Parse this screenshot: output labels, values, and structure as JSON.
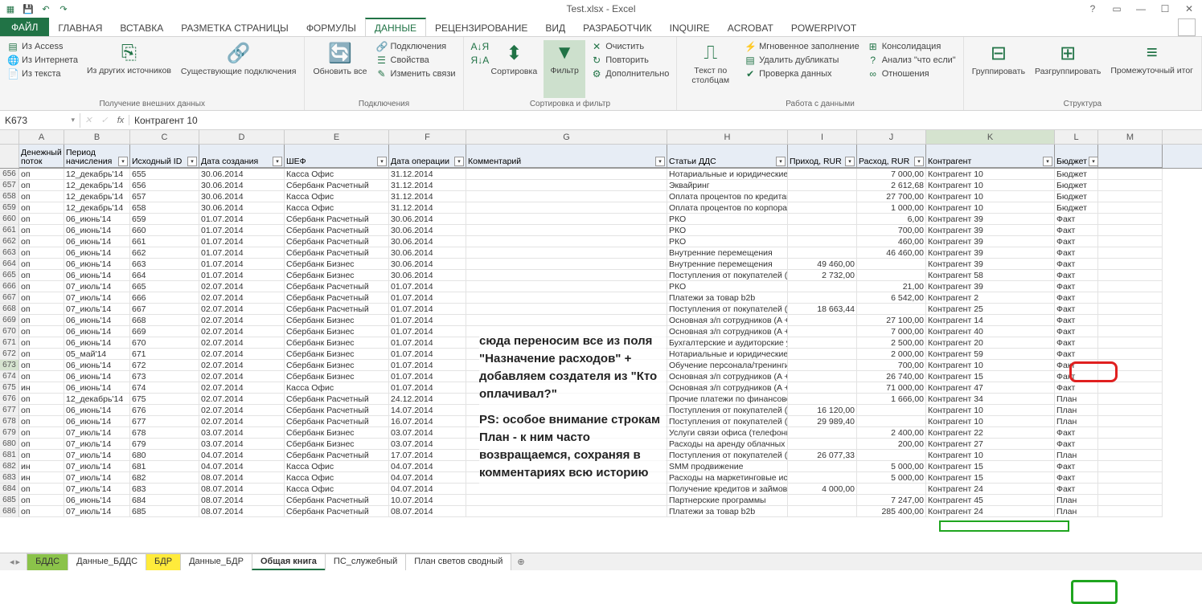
{
  "title": "Test.xlsx - Excel",
  "qat": {
    "save": "💾",
    "undo": "↶",
    "redo": "↷"
  },
  "tabs": {
    "file": "ФАЙЛ",
    "items": [
      "ГЛАВНАЯ",
      "ВСТАВКА",
      "РАЗМЕТКА СТРАНИЦЫ",
      "ФОРМУЛЫ",
      "ДАННЫЕ",
      "РЕЦЕНЗИРОВАНИЕ",
      "ВИД",
      "РАЗРАБОТЧИК",
      "INQUIRE",
      "ACROBAT",
      "POWERPIVOT"
    ],
    "active": "ДАННЫЕ"
  },
  "ribbon": {
    "ext": {
      "access": "Из Access",
      "web": "Из Интернета",
      "text": "Из текста",
      "other": "Из других источников",
      "existing": "Существующие подключения",
      "label": "Получение внешних данных"
    },
    "conn": {
      "refresh": "Обновить все",
      "connections": "Подключения",
      "properties": "Свойства",
      "editlinks": "Изменить связи",
      "label": "Подключения"
    },
    "sort": {
      "az": "А↓Я",
      "za": "Я↓А",
      "sort": "Сортировка",
      "filter": "Фильтр",
      "clear": "Очистить",
      "reapply": "Повторить",
      "advanced": "Дополнительно",
      "label": "Сортировка и фильтр"
    },
    "dtools": {
      "ttc": "Текст по столбцам",
      "flash": "Мгновенное заполнение",
      "dup": "Удалить дубликаты",
      "valid": "Проверка данных",
      "consol": "Консолидация",
      "whatif": "Анализ \"что если\"",
      "rel": "Отношения",
      "label": "Работа с данными"
    },
    "outline": {
      "group": "Группировать",
      "ungroup": "Разгруппировать",
      "subtotal": "Промежуточный итог",
      "label": "Структура"
    }
  },
  "namebox": "K673",
  "formula": "Контрагент 10",
  "columns": [
    "A",
    "B",
    "C",
    "D",
    "E",
    "F",
    "G",
    "H",
    "I",
    "J",
    "K",
    "L",
    "M"
  ],
  "headers": {
    "A": "Денежный поток",
    "B": "Период начисления",
    "C": "Исходный ID",
    "D": "Дата создания",
    "E": "ШЕФ",
    "F": "Дата операции",
    "G": "Комментарий",
    "H": "Статьи ДДС",
    "I": "Приход, RUR",
    "J": "Расход, RUR",
    "K": "Контрагент",
    "L": "Бюджет"
  },
  "comment_overlay": [
    "сюда переносим все из поля \"Назначение расходов\" + добавляем создателя из \"Кто оплачивал?\"",
    "PS: особое внимание строкам План - к ним часто возвращаемся, сохраняя в комментариях всю историю"
  ],
  "rows": [
    {
      "n": 656,
      "A": "оп",
      "B": "12_декабрь'14",
      "C": "655",
      "D": "30.06.2014",
      "E": "Касса Офис",
      "F": "31.12.2014",
      "H": "Нотариальные и юридические услуги",
      "I": "",
      "J": "7 000,00",
      "K": "Контрагент 10",
      "L": "Бюджет"
    },
    {
      "n": 657,
      "A": "оп",
      "B": "12_декабрь'14",
      "C": "656",
      "D": "30.06.2014",
      "E": "Сбербанк Расчетный",
      "F": "31.12.2014",
      "H": "Эквайринг",
      "I": "",
      "J": "2 612,68",
      "K": "Контрагент 10",
      "L": "Бюджет"
    },
    {
      "n": 658,
      "A": "оп",
      "B": "12_декабрь'14",
      "C": "657",
      "D": "30.06.2014",
      "E": "Касса Офис",
      "F": "31.12.2014",
      "H": "Оплата процентов по кредитам и займам",
      "I": "",
      "J": "27 700,00",
      "K": "Контрагент 10",
      "L": "Бюджет"
    },
    {
      "n": 659,
      "A": "оп",
      "B": "12_декабрь'14",
      "C": "658",
      "D": "30.06.2014",
      "E": "Касса Офис",
      "F": "31.12.2014",
      "H": "Оплата процентов по корпоративной кредитной",
      "I": "",
      "J": "1 000,00",
      "K": "Контрагент 10",
      "L": "Бюджет"
    },
    {
      "n": 660,
      "A": "оп",
      "B": "06_июнь'14",
      "C": "659",
      "D": "01.07.2014",
      "E": "Сбербанк Расчетный",
      "F": "30.06.2014",
      "H": "РКО",
      "I": "",
      "J": "6,00",
      "K": "Контрагент 39",
      "L": "Факт"
    },
    {
      "n": 661,
      "A": "оп",
      "B": "06_июнь'14",
      "C": "660",
      "D": "01.07.2014",
      "E": "Сбербанк Расчетный",
      "F": "30.06.2014",
      "H": "РКО",
      "I": "",
      "J": "700,00",
      "K": "Контрагент 39",
      "L": "Факт"
    },
    {
      "n": 662,
      "A": "оп",
      "B": "06_июнь'14",
      "C": "661",
      "D": "01.07.2014",
      "E": "Сбербанк Расчетный",
      "F": "30.06.2014",
      "H": "РКО",
      "I": "",
      "J": "460,00",
      "K": "Контрагент 39",
      "L": "Факт"
    },
    {
      "n": 663,
      "A": "оп",
      "B": "06_июнь'14",
      "C": "662",
      "D": "01.07.2014",
      "E": "Сбербанк Расчетный",
      "F": "30.06.2014",
      "H": "Внутренние перемещения",
      "I": "",
      "J": "46 460,00",
      "K": "Контрагент 39",
      "L": "Факт"
    },
    {
      "n": 664,
      "A": "оп",
      "B": "06_июнь'14",
      "C": "663",
      "D": "01.07.2014",
      "E": "Сбербанк Бизнес",
      "F": "30.06.2014",
      "H": "Внутренние перемещения",
      "I": "49 460,00",
      "J": "",
      "K": "Контрагент 39",
      "L": "Факт"
    },
    {
      "n": 665,
      "A": "оп",
      "B": "06_июнь'14",
      "C": "664",
      "D": "01.07.2014",
      "E": "Сбербанк Бизнес",
      "F": "30.06.2014",
      "H": "Поступления от покупателей (",
      "I": "2 732,00",
      "J": "",
      "K": "Контрагент 58",
      "L": "Факт"
    },
    {
      "n": 666,
      "A": "оп",
      "B": "07_июль'14",
      "C": "665",
      "D": "02.07.2014",
      "E": "Сбербанк Расчетный",
      "F": "01.07.2014",
      "H": "РКО",
      "I": "",
      "J": "21,00",
      "K": "Контрагент 39",
      "L": "Факт"
    },
    {
      "n": 667,
      "A": "оп",
      "B": "07_июль'14",
      "C": "666",
      "D": "02.07.2014",
      "E": "Сбербанк Расчетный",
      "F": "01.07.2014",
      "H": "Платежи за товар b2b",
      "I": "",
      "J": "6 542,00",
      "K": "Контрагент 2",
      "L": "Факт"
    },
    {
      "n": 668,
      "A": "оп",
      "B": "07_июль'14",
      "C": "667",
      "D": "02.07.2014",
      "E": "Сбербанк Расчетный",
      "F": "01.07.2014",
      "H": "Поступления от покупателей (",
      "I": "18 663,44",
      "J": "",
      "K": "Контрагент 25",
      "L": "Факт"
    },
    {
      "n": 669,
      "A": "оп",
      "B": "06_июнь'14",
      "C": "668",
      "D": "02.07.2014",
      "E": "Сбербанк Бизнес",
      "F": "01.07.2014",
      "H": "Основная з/п сотрудников (A + Z)",
      "I": "",
      "J": "27 100,00",
      "K": "Контрагент 14",
      "L": "Факт"
    },
    {
      "n": 670,
      "A": "оп",
      "B": "06_июнь'14",
      "C": "669",
      "D": "02.07.2014",
      "E": "Сбербанк Бизнес",
      "F": "01.07.2014",
      "H": "Основная з/п сотрудников (A + Z)",
      "I": "",
      "J": "7 000,00",
      "K": "Контрагент 40",
      "L": "Факт"
    },
    {
      "n": 671,
      "A": "оп",
      "B": "06_июнь'14",
      "C": "670",
      "D": "02.07.2014",
      "E": "Сбербанк Бизнес",
      "F": "01.07.2014",
      "H": "Бухгалтерские и аудиторские услуги",
      "I": "",
      "J": "2 500,00",
      "K": "Контрагент 20",
      "L": "Факт"
    },
    {
      "n": 672,
      "A": "оп",
      "B": "05_май'14",
      "C": "671",
      "D": "02.07.2014",
      "E": "Сбербанк Бизнес",
      "F": "01.07.2014",
      "H": "Нотариальные и юридические услуги",
      "I": "",
      "J": "2 000,00",
      "K": "Контрагент 59",
      "L": "Факт"
    },
    {
      "n": 673,
      "A": "оп",
      "B": "06_июнь'14",
      "C": "672",
      "D": "02.07.2014",
      "E": "Сбербанк Бизнес",
      "F": "01.07.2014",
      "H": "Обучение персонала/тренинги",
      "I": "",
      "J": "700,00",
      "K": "Контрагент 10",
      "L": "Факт"
    },
    {
      "n": 674,
      "A": "оп",
      "B": "06_июнь'14",
      "C": "673",
      "D": "02.07.2014",
      "E": "Сбербанк Бизнес",
      "F": "01.07.2014",
      "H": "Основная з/п сотрудников (A + Z)",
      "I": "",
      "J": "26 740,00",
      "K": "Контрагент 15",
      "L": "Факт"
    },
    {
      "n": 675,
      "A": "ин",
      "B": "06_июнь'14",
      "C": "674",
      "D": "02.07.2014",
      "E": "Касса Офис",
      "F": "01.07.2014",
      "H": "Основная з/п сотрудников (A + Z)",
      "I": "",
      "J": "71 000,00",
      "K": "Контрагент 47",
      "L": "Факт"
    },
    {
      "n": 676,
      "A": "оп",
      "B": "12_декабрь'14",
      "C": "675",
      "D": "02.07.2014",
      "E": "Сбербанк Расчетный",
      "F": "24.12.2014",
      "H": "Прочие платежи по финансовой деятельности",
      "I": "",
      "J": "1 666,00",
      "K": "Контрагент 34",
      "L": "План"
    },
    {
      "n": 677,
      "A": "оп",
      "B": "06_июнь'14",
      "C": "676",
      "D": "02.07.2014",
      "E": "Сбербанк Расчетный",
      "F": "14.07.2014",
      "H": "Поступления от покупателей (",
      "I": "16 120,00",
      "J": "",
      "K": "Контрагент 10",
      "L": "План"
    },
    {
      "n": 678,
      "A": "оп",
      "B": "06_июнь'14",
      "C": "677",
      "D": "02.07.2014",
      "E": "Сбербанк Расчетный",
      "F": "16.07.2014",
      "H": "Поступления от покупателей (",
      "I": "29 989,40",
      "J": "",
      "K": "Контрагент 10",
      "L": "План"
    },
    {
      "n": 679,
      "A": "оп",
      "B": "07_июль'14",
      "C": "678",
      "D": "03.07.2014",
      "E": "Сбербанк Бизнес",
      "F": "03.07.2014",
      "H": "Услуги связи офиса (телефония, Интернет)",
      "I": "",
      "J": "2 400,00",
      "K": "Контрагент 22",
      "L": "Факт"
    },
    {
      "n": 680,
      "A": "оп",
      "B": "07_июль'14",
      "C": "679",
      "D": "03.07.2014",
      "E": "Сбербанк Бизнес",
      "F": "03.07.2014",
      "H": "Расходы на аренду облачных продуктов",
      "I": "",
      "J": "200,00",
      "K": "Контрагент 27",
      "L": "Факт"
    },
    {
      "n": 681,
      "A": "оп",
      "B": "07_июль'14",
      "C": "680",
      "D": "04.07.2014",
      "E": "Сбербанк Расчетный",
      "F": "17.07.2014",
      "H": "Поступления от покупателей (",
      "I": "26 077,33",
      "J": "",
      "K": "Контрагент 10",
      "L": "План"
    },
    {
      "n": 682,
      "A": "ин",
      "B": "07_июль'14",
      "C": "681",
      "D": "04.07.2014",
      "E": "Касса Офис",
      "F": "04.07.2014",
      "H": "SMM продвижение",
      "I": "",
      "J": "5 000,00",
      "K": "Контрагент 15",
      "L": "Факт"
    },
    {
      "n": 683,
      "A": "ин",
      "B": "07_июль'14",
      "C": "682",
      "D": "08.07.2014",
      "E": "Касса Офис",
      "F": "04.07.2014",
      "H": "Расходы на маркетинговые исследования и об",
      "I": "",
      "J": "5 000,00",
      "K": "Контрагент 15",
      "L": "Факт"
    },
    {
      "n": 684,
      "A": "оп",
      "B": "07_июль'14",
      "C": "683",
      "D": "08.07.2014",
      "E": "Касса Офис",
      "F": "04.07.2014",
      "H": "Получение кредитов и займов",
      "I": "4 000,00",
      "J": "",
      "K": "Контрагент 24",
      "L": "Факт"
    },
    {
      "n": 685,
      "A": "оп",
      "B": "06_июнь'14",
      "C": "684",
      "D": "08.07.2014",
      "E": "Сбербанк Расчетный",
      "F": "10.07.2014",
      "H": "Партнерские программы",
      "I": "",
      "J": "7 247,00",
      "K": "Контрагент 45",
      "L": "План"
    },
    {
      "n": 686,
      "A": "оп",
      "B": "07_июль'14",
      "C": "685",
      "D": "08.07.2014",
      "E": "Сбербанк Расчетный",
      "F": "08.07.2014",
      "H": "Платежи за товар b2b",
      "I": "",
      "J": "285 400,00",
      "K": "Контрагент 24",
      "L": "План"
    }
  ],
  "sheets": [
    {
      "name": "БДДС",
      "cls": "g"
    },
    {
      "name": "Данные_БДДС",
      "cls": ""
    },
    {
      "name": "БДР",
      "cls": "y"
    },
    {
      "name": "Данные_БДР",
      "cls": ""
    },
    {
      "name": "Общая книга",
      "cls": "act"
    },
    {
      "name": "ПС_служебный",
      "cls": ""
    },
    {
      "name": "План светов сводный",
      "cls": ""
    }
  ]
}
